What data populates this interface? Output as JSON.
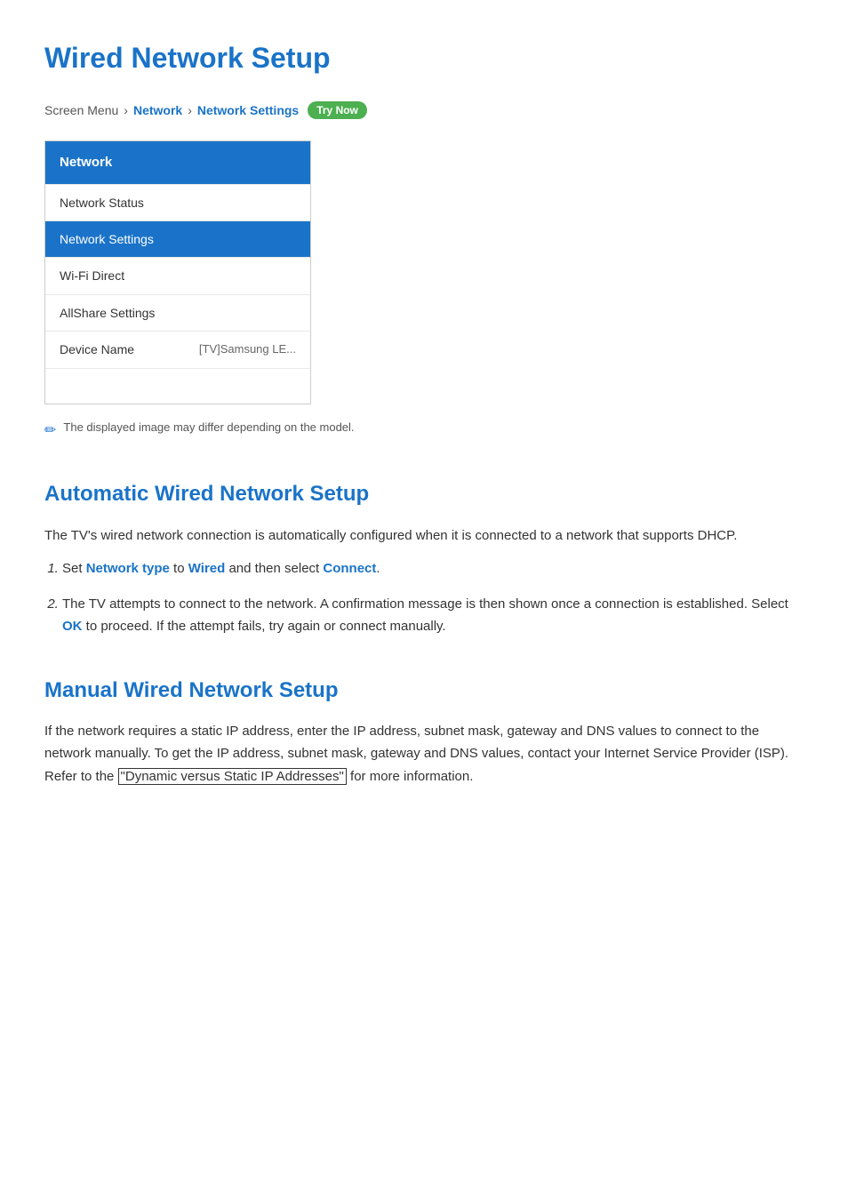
{
  "page": {
    "title": "Wired Network Setup",
    "breadcrumb": {
      "items": [
        {
          "label": "Screen Menu",
          "type": "text"
        },
        {
          "label": "Network",
          "type": "link"
        },
        {
          "label": "Network Settings",
          "type": "link"
        }
      ],
      "try_now_label": "Try Now"
    },
    "menu": {
      "header": "Network",
      "items": [
        {
          "label": "Network Status",
          "value": "",
          "active": false
        },
        {
          "label": "Network Settings",
          "value": "",
          "active": true
        },
        {
          "label": "Wi-Fi Direct",
          "value": "",
          "active": false
        },
        {
          "label": "AllShare Settings",
          "value": "",
          "active": false
        },
        {
          "label": "Device Name",
          "value": "[TV]Samsung LE...",
          "active": false
        }
      ]
    },
    "note": "The displayed image may differ depending on the model.",
    "automatic_section": {
      "title": "Automatic Wired Network Setup",
      "intro": "The TV's wired network connection is automatically configured when it is connected to a network that supports DHCP.",
      "steps": [
        {
          "number": "1.",
          "text_before": "Set ",
          "highlight1": "Network type",
          "text_middle1": " to ",
          "highlight2": "Wired",
          "text_middle2": " and then select ",
          "highlight3": "Connect",
          "text_after": "."
        },
        {
          "number": "2.",
          "text_plain": "The TV attempts to connect to the network. A confirmation message is then shown once a connection is established. Select ",
          "highlight_ok": "OK",
          "text_after": " to proceed. If the attempt fails, try again or connect manually."
        }
      ]
    },
    "manual_section": {
      "title": "Manual Wired Network Setup",
      "text_before": "If the network requires a static IP address, enter the IP address, subnet mask, gateway and DNS values to connect to the network manually. To get the IP address, subnet mask, gateway and DNS values, contact your Internet Service Provider (ISP). Refer to the ",
      "link_label": "\"Dynamic versus Static IP Addresses\"",
      "text_after": " for more information."
    }
  }
}
